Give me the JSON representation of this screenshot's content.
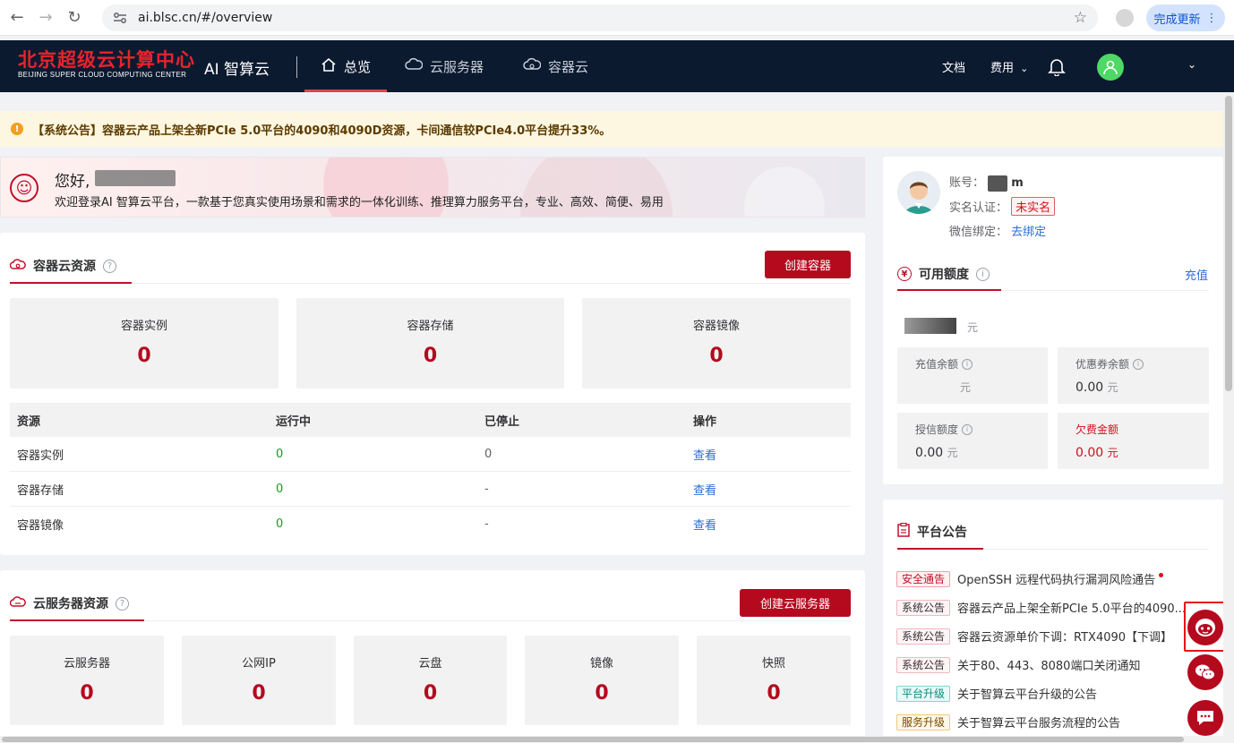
{
  "browser": {
    "url": "ai.blsc.cn/#/overview",
    "update_button": "完成更新"
  },
  "header": {
    "logo_cn": "北京超级云计算中心",
    "logo_en": "BEIJING SUPER CLOUD COMPUTING CENTER",
    "app_name": "AI 智算云",
    "tabs": [
      {
        "label": "总览",
        "icon": "home-icon",
        "active": true
      },
      {
        "label": "云服务器",
        "icon": "cloud-server-icon",
        "active": false
      },
      {
        "label": "容器云",
        "icon": "container-cloud-icon",
        "active": false
      }
    ],
    "docs_label": "文档",
    "fees_label": "费用"
  },
  "notice": {
    "text": "【系统公告】容器云产品上架全新PCIe 5.0平台的4090和4090D资源，卡间通信较PCIe4.0平台提升33%。"
  },
  "welcome": {
    "hello": "您好,",
    "desc": "欢迎登录AI 智算云平台，一款基于您真实使用场景和需求的一体化训练、推理算力服务平台，专业、高效、简便、易用"
  },
  "container": {
    "title": "容器云资源",
    "help": "?",
    "create_button": "创建容器",
    "stats": [
      {
        "label": "容器实例",
        "value": "0"
      },
      {
        "label": "容器存储",
        "value": "0"
      },
      {
        "label": "容器镜像",
        "value": "0"
      }
    ],
    "table": {
      "headers": [
        "资源",
        "运行中",
        "已停止",
        "操作"
      ],
      "rows": [
        {
          "name": "容器实例",
          "running": "0",
          "stopped": "0",
          "action": "查看"
        },
        {
          "name": "容器存储",
          "running": "0",
          "stopped": "-",
          "action": "查看"
        },
        {
          "name": "容器镜像",
          "running": "0",
          "stopped": "-",
          "action": "查看"
        }
      ]
    }
  },
  "cloud_server": {
    "title": "云服务器资源",
    "help": "?",
    "create_button": "创建云服务器",
    "stats": [
      {
        "label": "云服务器",
        "value": "0"
      },
      {
        "label": "公网IP",
        "value": "0"
      },
      {
        "label": "云盘",
        "value": "0"
      },
      {
        "label": "镜像",
        "value": "0"
      },
      {
        "label": "快照",
        "value": "0"
      }
    ]
  },
  "account": {
    "account_label": "账号：",
    "account_suffix": "m",
    "realname_label": "实名认证：",
    "realname_status": "未实名",
    "wechat_label": "微信绑定：",
    "wechat_action": "去绑定"
  },
  "quota": {
    "title": "可用额度",
    "recharge": "充值",
    "unit": "元",
    "boxes": [
      {
        "label": "充值余额",
        "value": "",
        "unit": "元",
        "info": true,
        "highlight": false
      },
      {
        "label": "优惠券余额",
        "value": "0.00",
        "unit": "元",
        "info": true,
        "highlight": false
      },
      {
        "label": "授信额度",
        "value": "0.00",
        "unit": "元",
        "info": true,
        "highlight": false
      },
      {
        "label": "欠费金额",
        "value": "0.00",
        "unit": "元",
        "info": false,
        "highlight": true
      }
    ]
  },
  "announcements": {
    "title": "平台公告",
    "items": [
      {
        "tag": "安全通告",
        "style": "red",
        "text": "OpenSSH 远程代码执行漏洞风险通告",
        "dot": true
      },
      {
        "tag": "系统公告",
        "style": "pink",
        "text": "容器云产品上架全新PCIe 5.0平台的4090...",
        "dot": false
      },
      {
        "tag": "系统公告",
        "style": "pink",
        "text": "容器云资源单价下调：RTX4090【下调】",
        "dot": false
      },
      {
        "tag": "系统公告",
        "style": "pink",
        "text": "关于80、443、8080端口关闭通知",
        "dot": false
      },
      {
        "tag": "平台升级",
        "style": "teal",
        "text": "关于智算云平台升级的公告",
        "dot": false
      },
      {
        "tag": "服务升级",
        "style": "amber",
        "text": "关于智算云平台服务流程的公告",
        "dot": false
      }
    ]
  },
  "colors": {
    "brand_red": "#b5091e",
    "header_bg": "#0c1a30",
    "link_blue": "#2a6fd6",
    "running_green": "#15a020"
  }
}
